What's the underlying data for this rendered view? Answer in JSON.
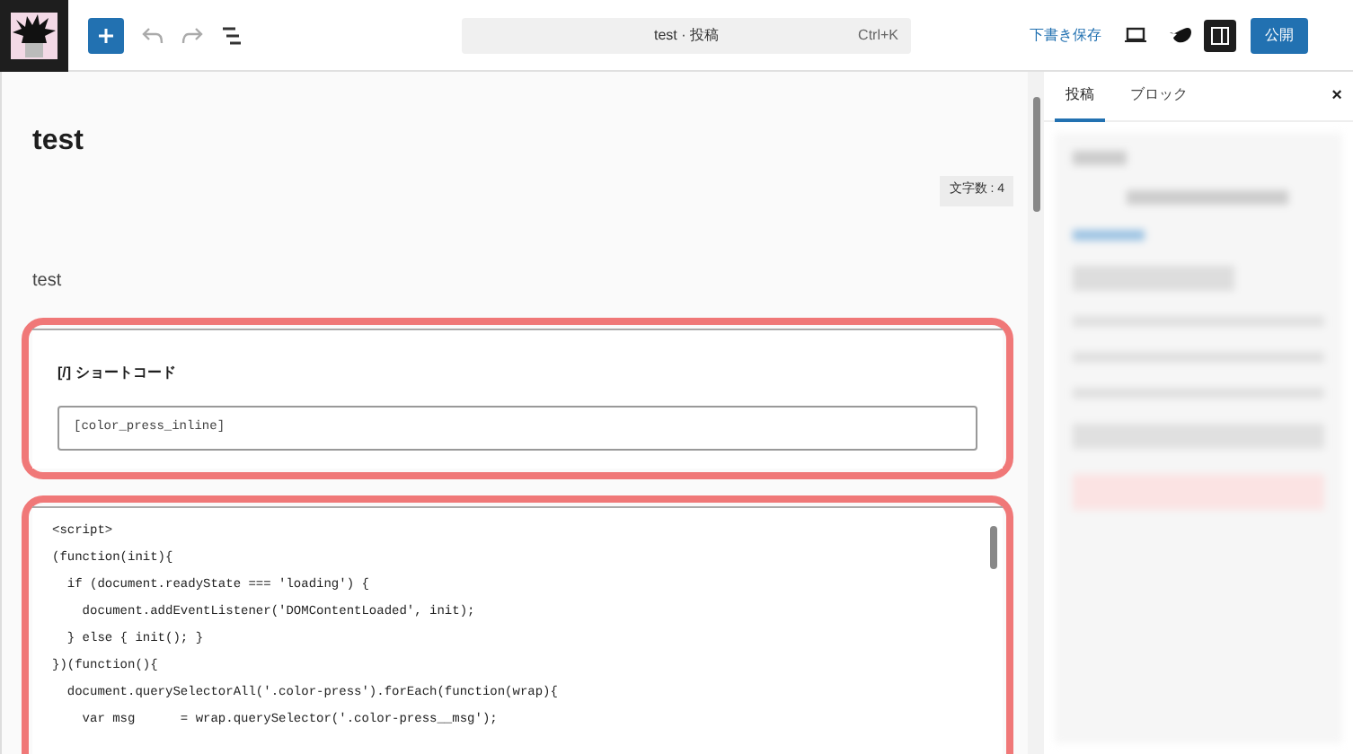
{
  "toolbar": {
    "command_bar": {
      "title": "test · 投稿",
      "shortcut": "Ctrl+K"
    },
    "save_draft": "下書き保存",
    "publish": "公開",
    "sidebar_toggle": {
      "selected": true
    }
  },
  "editor": {
    "title": "test",
    "word_count": "文字数 : 4",
    "paragraph": "test",
    "shortcode": {
      "label": "[/] ショートコード",
      "value": "[color_press_inline]"
    },
    "code_lines": [
      "<script>",
      "(function(init){",
      "  if (document.readyState === 'loading') {",
      "    document.addEventListener('DOMContentLoaded', init);",
      "  } else { init(); }",
      "})(function(){",
      "  document.querySelectorAll('.color-press').forEach(function(wrap){",
      "    var msg      = wrap.querySelector('.color-press__msg');"
    ]
  },
  "sidebar": {
    "tabs": [
      {
        "label": "投稿",
        "selected": true
      },
      {
        "label": "ブロック",
        "selected": false
      }
    ],
    "close": "×"
  }
}
